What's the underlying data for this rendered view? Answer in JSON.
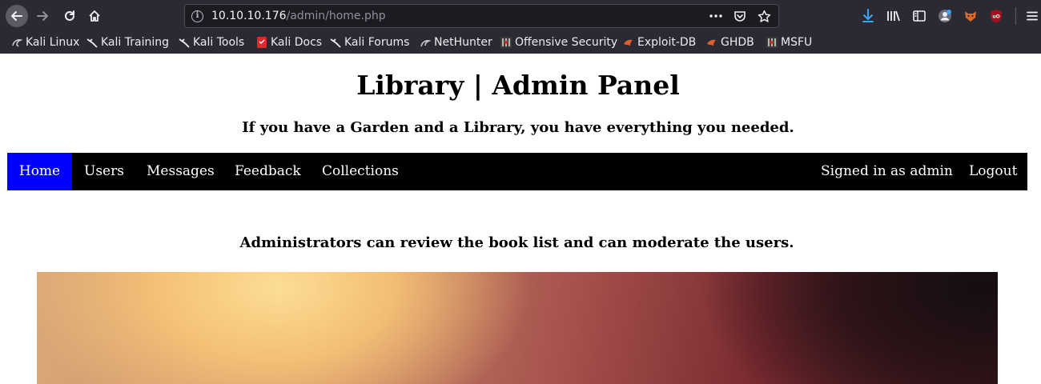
{
  "browser": {
    "url_host": "10.10.10.176",
    "url_path": "/admin/home.php",
    "bookmarks": [
      {
        "label": "Kali Linux",
        "icon": "kali-dragon-icon"
      },
      {
        "label": "Kali Training",
        "icon": "kali-dragon-icon"
      },
      {
        "label": "Kali Tools",
        "icon": "kali-dragon-icon"
      },
      {
        "label": "Kali Docs",
        "icon": "kali-docs-icon"
      },
      {
        "label": "Kali Forums",
        "icon": "kali-dragon-icon"
      },
      {
        "label": "NetHunter",
        "icon": "nethunter-icon"
      },
      {
        "label": "Offensive Security",
        "icon": "offsec-icon"
      },
      {
        "label": "Exploit-DB",
        "icon": "exploitdb-icon"
      },
      {
        "label": "GHDB",
        "icon": "exploitdb-icon"
      },
      {
        "label": "MSFU",
        "icon": "offsec-icon"
      }
    ]
  },
  "page": {
    "title": "Library | Admin Panel",
    "subtitle": "If you have a Garden and a Library, you have everything you needed.",
    "nav": {
      "home": "Home",
      "users": "Users",
      "messages": "Messages",
      "feedback": "Feedback",
      "collections": "Collections",
      "signed_in": "Signed in as admin",
      "logout": "Logout"
    },
    "admin_text": "Administrators can review the book list and can moderate the users."
  },
  "colors": {
    "nav_active": "#0000ff",
    "nav_bg": "#000000",
    "chrome_bg": "#2b2a33"
  }
}
